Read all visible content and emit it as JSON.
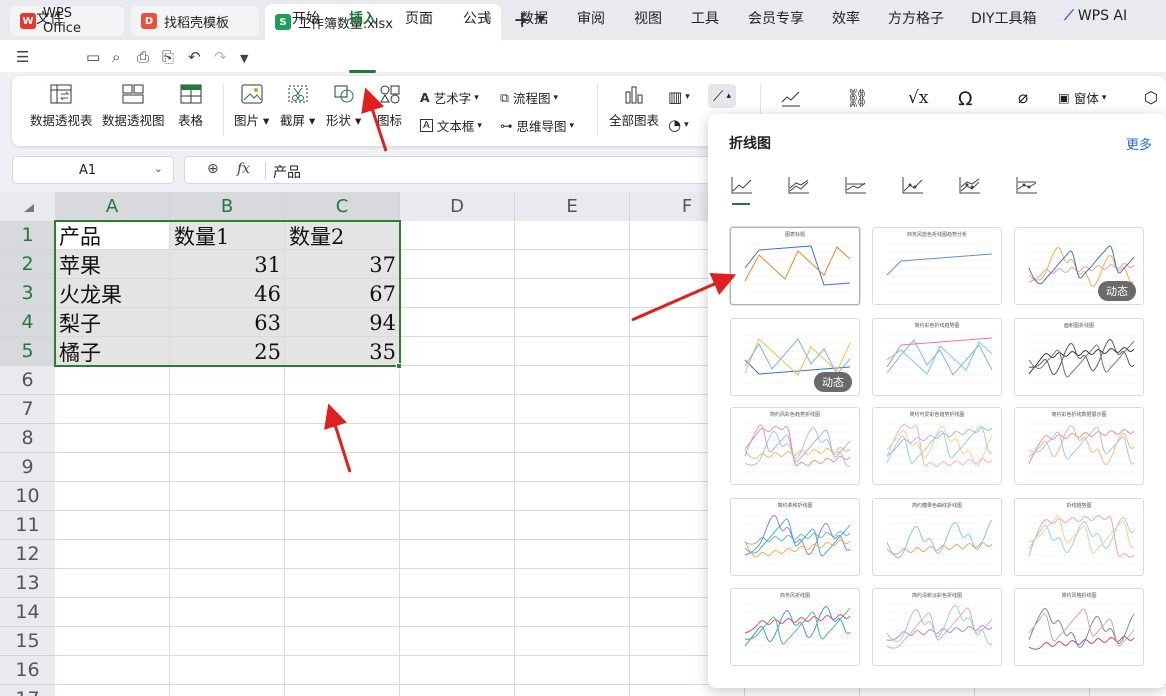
{
  "tabs": [
    {
      "label": "WPS Office",
      "logo": "W"
    },
    {
      "label": "找稻壳模板",
      "logo": "D"
    },
    {
      "label": "工作簿数量.xlsx",
      "logo": "S"
    }
  ],
  "menu": {
    "file": "文件",
    "items": [
      "开始",
      "插入",
      "页面",
      "公式",
      "数据",
      "审阅",
      "视图",
      "工具",
      "会员专享",
      "效率",
      "方方格子",
      "DIY工具箱"
    ],
    "active": "插入",
    "wps_ai": "WPS AI"
  },
  "ribbon": {
    "pivot_table": "数据透视表",
    "pivot_chart": "数据透视图",
    "table": "表格",
    "picture": "图片",
    "screenshot": "截屏",
    "shape": "形状",
    "icon": "图标",
    "wordart": "艺术字",
    "textbox": "文本框",
    "flowchart": "流程图",
    "mindmap": "思维导图",
    "all_charts": "全部图表",
    "window": "窗体"
  },
  "namebox": "A1",
  "formula": "产品",
  "columns": [
    "A",
    "B",
    "C",
    "D",
    "E",
    "F"
  ],
  "rows": [
    "1",
    "2",
    "3",
    "4",
    "5",
    "6",
    "7",
    "8",
    "9",
    "10",
    "11",
    "12",
    "13",
    "14",
    "15",
    "16",
    "17"
  ],
  "table": {
    "header": [
      "产品",
      "数量1",
      "数量2"
    ],
    "rows": [
      [
        "苹果",
        "31",
        "37"
      ],
      [
        "火龙果",
        "46",
        "67"
      ],
      [
        "梨子",
        "63",
        "94"
      ],
      [
        "橘子",
        "25",
        "35"
      ]
    ]
  },
  "popup": {
    "title": "折线图",
    "more": "更多",
    "badge": "动态",
    "thumb_titles": [
      "图表标题",
      "商务风蓝色折线图趋势分析",
      "",
      "",
      "简约彩色折线趋势图",
      "面积图折线图",
      "简约风彩色趋势折线图",
      "简约可爱彩色趋势折线图",
      "简约彩色折线数据展示图",
      "简约柔和折线图",
      "简约糖果色曲线折线图",
      "折线趋势图",
      "商务风折线图",
      "简约清新淡彩色折线图",
      "简约风格折线图"
    ]
  },
  "colors": {
    "accent": "#217a3c",
    "selection": "#2e7d32",
    "link": "#1e6fd9",
    "arrow": "#e02020"
  }
}
